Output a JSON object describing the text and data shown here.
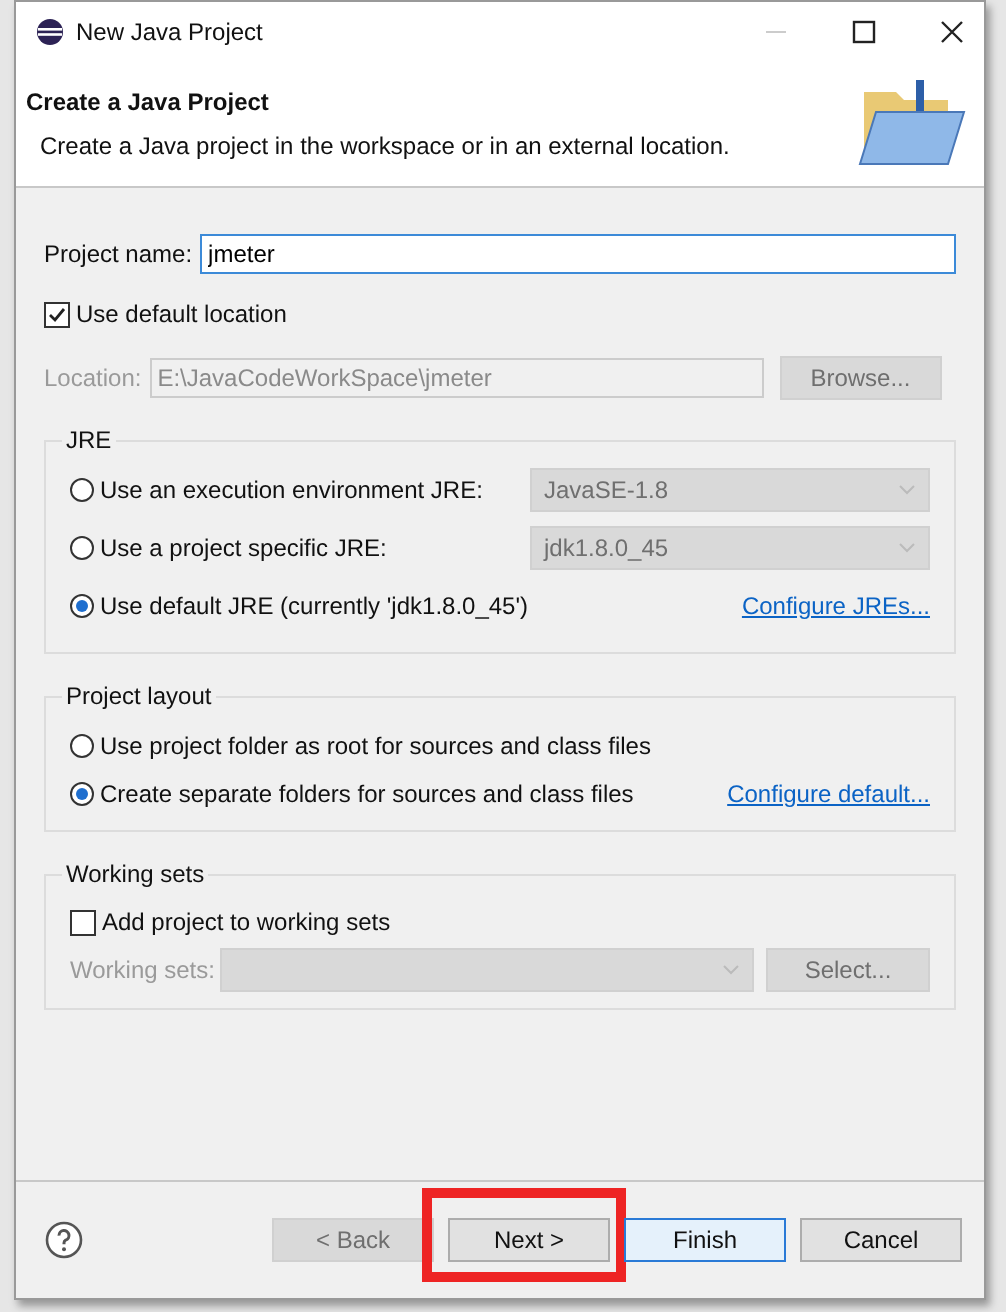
{
  "window": {
    "title": "New Java Project"
  },
  "header": {
    "title": "Create a Java Project",
    "description": "Create a Java project in the workspace or in an external location."
  },
  "project_name": {
    "label": "Project name:",
    "value": "jmeter"
  },
  "use_default_location": {
    "label": "Use default location",
    "checked": true
  },
  "location": {
    "label": "Location:",
    "value": "E:\\JavaCodeWorkSpace\\jmeter",
    "disabled": true,
    "button": "Browse..."
  },
  "jre": {
    "title": "JRE",
    "options": [
      {
        "label": "Use an execution environment JRE:",
        "selected": false,
        "kind": "combo",
        "combo": "JavaSE-1.8",
        "disabled": true
      },
      {
        "label": "Use a project specific JRE:",
        "selected": false,
        "kind": "combo",
        "combo": "jdk1.8.0_45",
        "disabled": true
      },
      {
        "label": "Use default JRE (currently 'jdk1.8.0_45')",
        "selected": true,
        "kind": "link",
        "link": "Configure JREs..."
      }
    ]
  },
  "project_layout": {
    "title": "Project layout",
    "options": [
      {
        "label": "Use project folder as root for sources and class files",
        "selected": false,
        "kind": "plain"
      },
      {
        "label": "Create separate folders for sources and class files",
        "selected": true,
        "kind": "link",
        "link": "Configure default..."
      }
    ]
  },
  "working_sets": {
    "title": "Working sets",
    "add": {
      "label": "Add project to working sets",
      "checked": false
    },
    "field_label": "Working sets:",
    "disabled": true,
    "button": "Select..."
  },
  "buttons": [
    {
      "label": "< Back",
      "disabled": true,
      "default": false,
      "highlighted": false
    },
    {
      "label": "Next >",
      "disabled": false,
      "default": false,
      "highlighted": true
    },
    {
      "label": "Finish",
      "disabled": false,
      "default": true,
      "highlighted": false
    },
    {
      "label": "Cancel",
      "disabled": false,
      "default": false,
      "highlighted": false
    }
  ]
}
